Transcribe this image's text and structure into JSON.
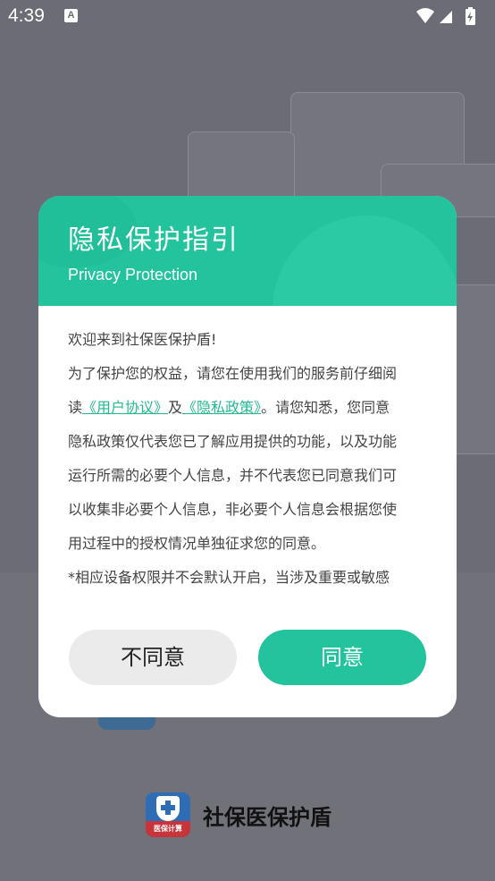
{
  "status_bar": {
    "time": "4:39",
    "notification_icon": "A",
    "icons": [
      "wifi-icon",
      "signal-icon",
      "battery-charging-icon"
    ]
  },
  "dialog": {
    "title": "隐私保护指引",
    "subtitle": "Privacy Protection",
    "body": {
      "line1": "欢迎来到社保医保护盾!",
      "line2": "为了保护您的权益，请您在使用我们的服务前仔细阅",
      "line3_prefix": "读",
      "user_agreement_link": "《用户协议》",
      "line3_and": "及",
      "privacy_policy_link": "《隐私政策》",
      "line3_suffix": "。请您知悉，您同意",
      "line4": "隐私政策仅代表您已了解应用提供的功能，以及功能",
      "line5": "运行所需的必要个人信息，并不代表您已同意我们可",
      "line6": "以收集非必要个人信息，非必要个人信息会根据您使",
      "line7": "用过程中的授权情况单独征求您的同意。",
      "line8": "*相应设备权限并不会默认开启，当涉及重要或敏感"
    },
    "disagree_label": "不同意",
    "agree_label": "同意"
  },
  "app": {
    "name": "社保医保护盾",
    "logo_text": "医保计算"
  },
  "colors": {
    "accent": "#23c39d",
    "link": "#23b995",
    "overlay": "#6b6c75"
  }
}
